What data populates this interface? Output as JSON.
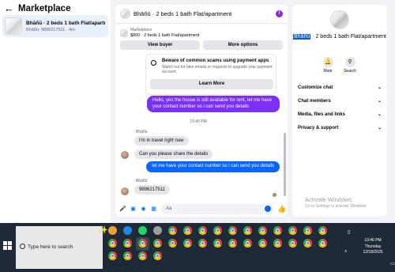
{
  "left_panel": {
    "title": "Marketplace",
    "conversation": {
      "title": "Bhāñū · 2 beds 1 bath Flat/apartment",
      "subtitle": "Bhāñū: 9896217511 · 4m"
    }
  },
  "chat": {
    "header_title": "Bhāñū · 2 beds 1 bath Flat/apartment",
    "listing": {
      "label": "Marketplace",
      "summary": "$800 · 2 beds 1 bath Flat/apartment"
    },
    "buttons": {
      "view_buyer": "View buyer",
      "more_options": "More options"
    },
    "scam_notice": {
      "title": "Beware of common scams using payment apps",
      "body": "Watch out for fake emails or requests to upgrade your payment account.",
      "button": "Learn More"
    },
    "messages": {
      "out_1": "Hello, yes the house is still available for rent, let me have your contact number so i can send you details",
      "timestamp": "10:40 PM",
      "sender_1": "Bhāñū",
      "in_1": "I'm in travel right now",
      "in_2": "Can you please share the details",
      "out_2": "let me have your contact number so i can send you details",
      "sender_2": "Bhāñū",
      "in_3": "9896217511"
    },
    "composer": {
      "placeholder": "Aa"
    }
  },
  "right_panel": {
    "name_highlight": "Bhāñū",
    "name_rest": " · 2 beds 1 bath Flat/apartment",
    "actions": {
      "mute": "Mute",
      "search": "Search"
    },
    "sections": [
      "Customize chat",
      "Chat members",
      "Media, files and links",
      "Privacy & support"
    ]
  },
  "watermark": {
    "line1": "Activate Windows",
    "line2": "Go to Settings to activate Windows."
  },
  "taskbar": {
    "search_placeholder": "Type here to search",
    "time": "10:46 PM",
    "day": "Thursday",
    "date": "12/18/2025"
  },
  "colors": {
    "accent_purple": "#7b2ff7",
    "accent_blue": "#0866ff"
  }
}
